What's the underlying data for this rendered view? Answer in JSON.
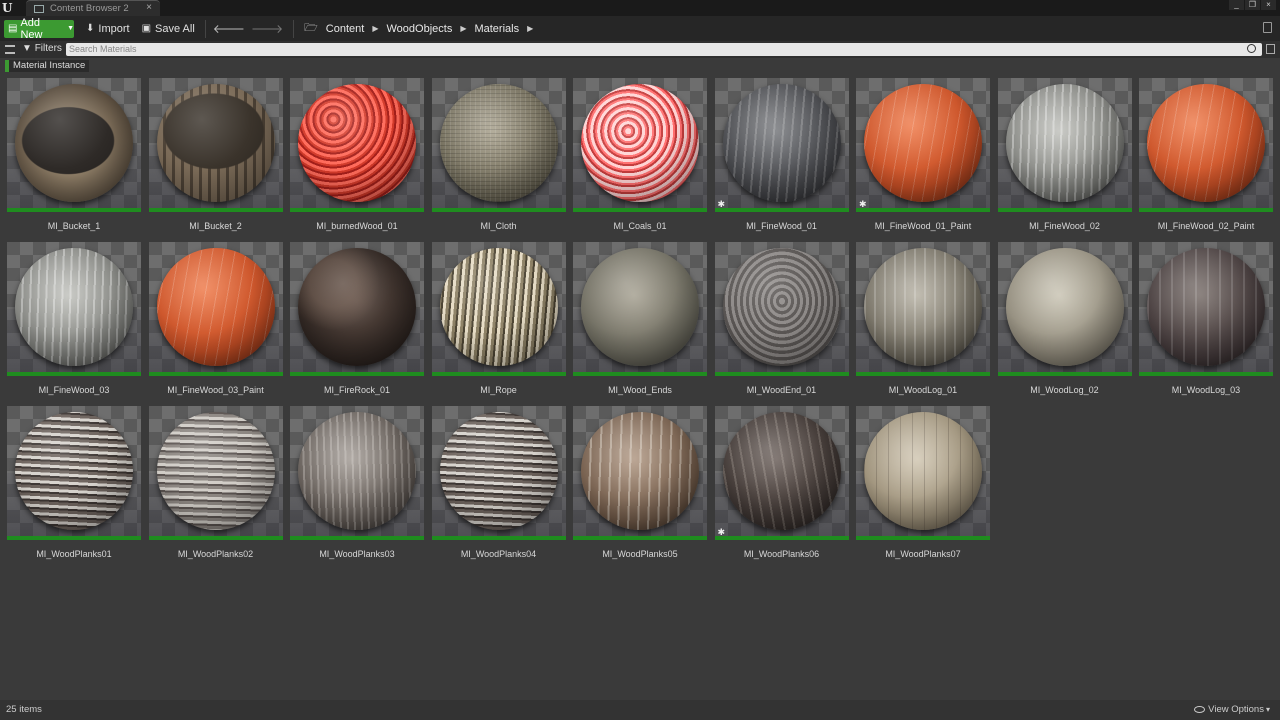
{
  "window": {
    "tab_label": "Content Browser 2",
    "close_glyph": "×",
    "controls": [
      "_",
      "❐",
      "×"
    ]
  },
  "toolbar": {
    "add_new_label": "Add New",
    "import_label": "Import",
    "save_all_label": "Save All",
    "breadcrumbs": [
      "Content",
      "WoodObjects",
      "Materials"
    ]
  },
  "filters": {
    "filters_label": "Filters",
    "search_placeholder": "Search Materials",
    "active_filter": "Material Instance",
    "active_filter_color": "#3c9a32"
  },
  "assets": [
    {
      "name": "MI_Bucket_1",
      "starred": false,
      "tex": "bucket1"
    },
    {
      "name": "MI_Bucket_2",
      "starred": false,
      "tex": "bucket2"
    },
    {
      "name": "MI_burnedWood_01",
      "starred": false,
      "tex": "burned"
    },
    {
      "name": "MI_Cloth",
      "starred": false,
      "tex": "cloth"
    },
    {
      "name": "MI_Coals_01",
      "starred": false,
      "tex": "coals"
    },
    {
      "name": "MI_FineWood_01",
      "starred": true,
      "tex": "darkwood"
    },
    {
      "name": "MI_FineWood_01_Paint",
      "starred": true,
      "tex": "paint"
    },
    {
      "name": "MI_FineWood_02",
      "starred": false,
      "tex": "greywood"
    },
    {
      "name": "MI_FineWood_02_Paint",
      "starred": false,
      "tex": "paint"
    },
    {
      "name": "MI_FineWood_03",
      "starred": false,
      "tex": "greywood"
    },
    {
      "name": "MI_FineWood_03_Paint",
      "starred": false,
      "tex": "paint"
    },
    {
      "name": "MI_FireRock_01",
      "starred": false,
      "tex": "firerock"
    },
    {
      "name": "MI_Rope",
      "starred": false,
      "tex": "rope"
    },
    {
      "name": "MI_Wood_Ends",
      "starred": false,
      "tex": "ends"
    },
    {
      "name": "MI_WoodEnd_01",
      "starred": false,
      "tex": "woodend"
    },
    {
      "name": "MI_WoodLog_01",
      "starred": false,
      "tex": "log1"
    },
    {
      "name": "MI_WoodLog_02",
      "starred": false,
      "tex": "log2"
    },
    {
      "name": "MI_WoodLog_03",
      "starred": false,
      "tex": "log3"
    },
    {
      "name": "MI_WoodPlanks01",
      "starred": false,
      "tex": "planks"
    },
    {
      "name": "MI_WoodPlanks02",
      "starred": false,
      "tex": "planks2"
    },
    {
      "name": "MI_WoodPlanks03",
      "starred": false,
      "tex": "planks3"
    },
    {
      "name": "MI_WoodPlanks04",
      "starred": false,
      "tex": "planks"
    },
    {
      "name": "MI_WoodPlanks05",
      "starred": false,
      "tex": "planks5"
    },
    {
      "name": "MI_WoodPlanks06",
      "starred": true,
      "tex": "planks6"
    },
    {
      "name": "MI_WoodPlanks07",
      "starred": false,
      "tex": "planks7"
    }
  ],
  "status": {
    "item_count": "25 items",
    "view_options_label": "View Options",
    "view_options_caret": "▾"
  }
}
